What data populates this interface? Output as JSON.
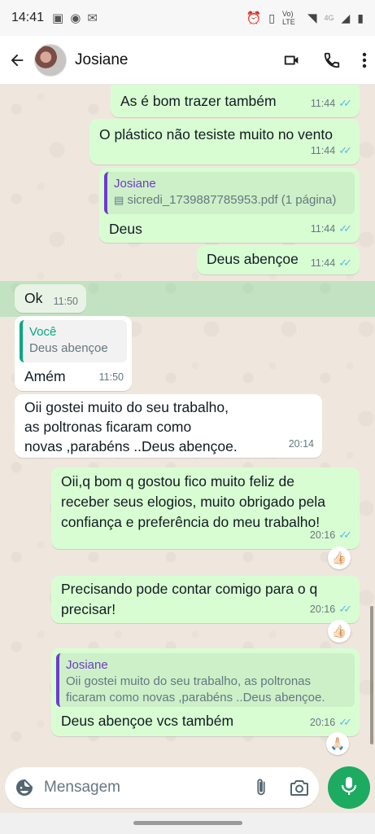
{
  "status_bar": {
    "time": "14:41",
    "network_label": "Vo) LTE",
    "signal_label": "4G"
  },
  "header": {
    "contact_name": "Josiane"
  },
  "messages": [
    {
      "text": "As é bom trazer também",
      "time": "11:44"
    },
    {
      "text": "O plástico não tesiste muito no vento",
      "time": "11:44"
    },
    {
      "quote_name": "Josiane",
      "quote_text": "sicredi_1739887785953.pdf (1 página)",
      "text": "Deus",
      "time": "11:44"
    },
    {
      "text": "Deus abençoe",
      "time": "11:44"
    },
    {
      "text": "Ok",
      "time": "11:50"
    },
    {
      "quote_name": "Você",
      "quote_text": "Deus abençoe",
      "text": "Amém",
      "time": "11:50"
    },
    {
      "lines": [
        "Oii gostei muito do seu trabalho,",
        "as poltronas ficaram como",
        "novas ,parabéns ..Deus abençoe."
      ],
      "time": "20:14"
    },
    {
      "lines": [
        "Oii,q bom q gostou fico muito feliz de",
        "receber seus elogios, muito obrigado pela",
        "confiança e preferência do meu trabalho!"
      ],
      "time": "20:16",
      "reaction": "👍🏻"
    },
    {
      "lines": [
        "Precisando pode contar comigo para o q",
        "precisar!"
      ],
      "time": "20:16",
      "reaction": "👍🏻"
    },
    {
      "quote_name": "Josiane",
      "quote_lines": [
        "Oii gostei muito do seu trabalho, as poltronas",
        "ficaram como novas ,parabéns ..Deus abençoe."
      ],
      "text": "Deus abençoe vcs também",
      "time": "20:16",
      "reaction": "🙏🏻"
    }
  ],
  "composer": {
    "placeholder": "Mensagem"
  },
  "colors": {
    "outgoing_bubble": "#d9fdd3",
    "incoming_bubble": "#ffffff",
    "accent_green": "#1daa61",
    "read_ticks": "#53bdeb"
  },
  "icons": {
    "back": "arrow-left-icon",
    "video": "video-camera-icon",
    "call": "phone-icon",
    "menu": "more-vertical-icon",
    "emoji": "sticker-icon",
    "attach": "paperclip-icon",
    "camera": "camera-icon",
    "mic": "microphone-icon"
  }
}
